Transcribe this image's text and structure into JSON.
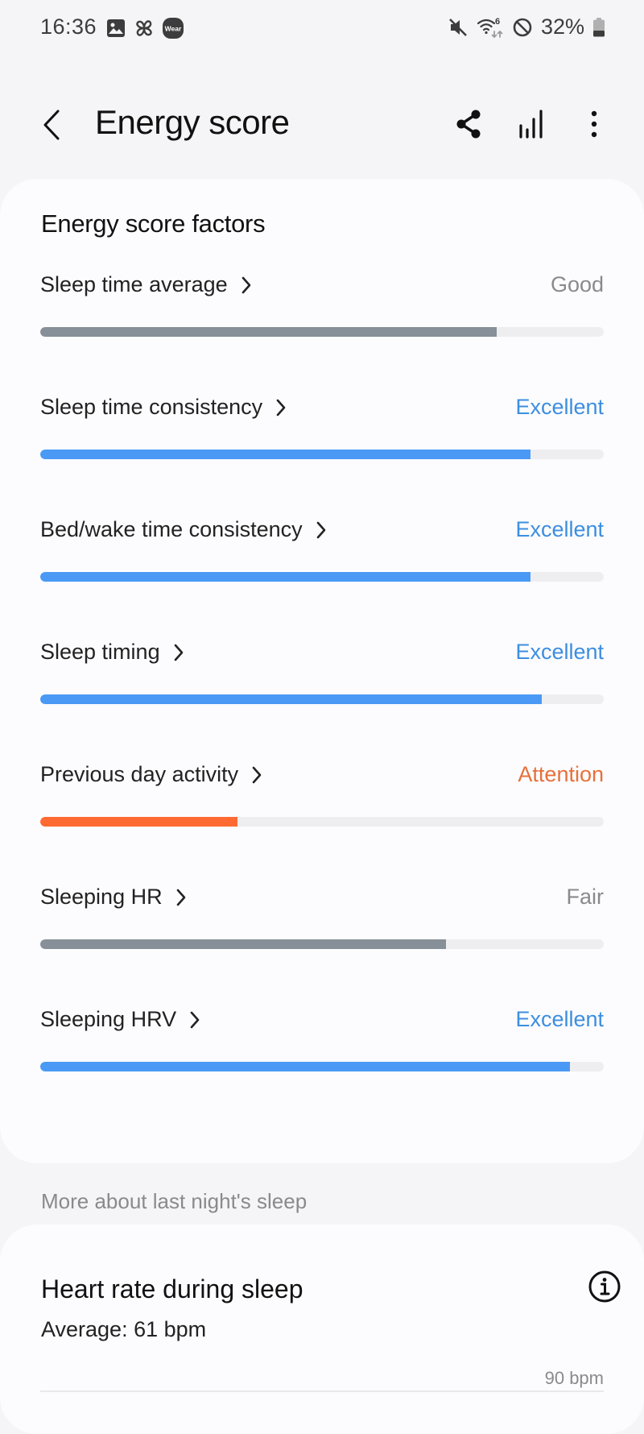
{
  "status_bar": {
    "time": "16:36",
    "left_icons": [
      "gallery-icon",
      "pinwheel-icon",
      "wear-icon"
    ],
    "wear_label": "Wear",
    "right_icons": [
      "mute-icon",
      "wifi-icon",
      "do-not-disturb-icon",
      "battery-icon"
    ],
    "wifi_badge": "6",
    "battery": "32%"
  },
  "app_bar": {
    "title": "Energy score",
    "actions": [
      "share-icon",
      "chart-icon",
      "more-icon"
    ]
  },
  "factors": {
    "title": "Energy score factors",
    "items": [
      {
        "label": "Sleep time average",
        "rating": "Good",
        "progress": 0.81,
        "status": "neutral"
      },
      {
        "label": "Sleep time consistency",
        "rating": "Excellent",
        "progress": 0.87,
        "status": "excellent"
      },
      {
        "label": "Bed/wake time consistency",
        "rating": "Excellent",
        "progress": 0.87,
        "status": "excellent"
      },
      {
        "label": "Sleep timing",
        "rating": "Excellent",
        "progress": 0.89,
        "status": "excellent"
      },
      {
        "label": "Previous day activity",
        "rating": "Attention",
        "progress": 0.35,
        "status": "attention"
      },
      {
        "label": "Sleeping HR",
        "rating": "Fair",
        "progress": 0.72,
        "status": "neutral"
      },
      {
        "label": "Sleeping HRV",
        "rating": "Excellent",
        "progress": 0.94,
        "status": "excellent"
      }
    ]
  },
  "colors": {
    "excellent_text": "#3d8ee0",
    "excellent_bar": "#4a9af5",
    "neutral_text": "#8a8a8c",
    "neutral_bar": "#878f98",
    "attention_text": "#e8703a",
    "attention_bar": "#ff6a33"
  },
  "more_section": {
    "label": "More about last night's sleep"
  },
  "heart_rate": {
    "title": "Heart rate during sleep",
    "average": "Average: 61 bpm",
    "max_label": "90 bpm"
  }
}
